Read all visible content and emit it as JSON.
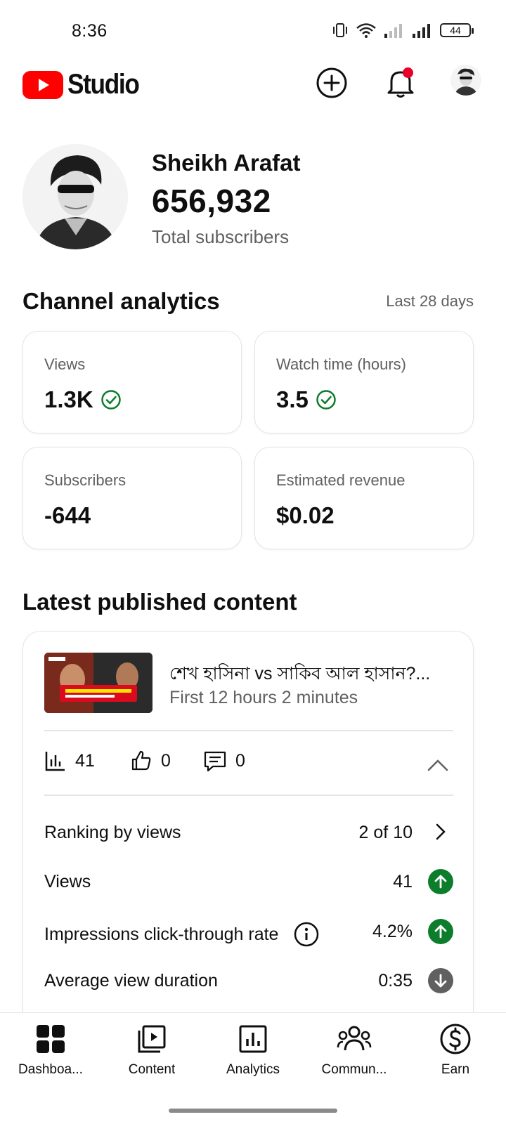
{
  "status_bar": {
    "time": "8:36",
    "battery": "44"
  },
  "header": {
    "logo_text": "Studio",
    "brand_color": "#ff0000",
    "notification_dot_color": "#e8002a"
  },
  "channel": {
    "name": "Sheikh Arafat",
    "subscribers": "656,932",
    "subscribers_label": "Total subscribers"
  },
  "analytics": {
    "title": "Channel analytics",
    "period": "Last 28 days",
    "cards": {
      "views": {
        "label": "Views",
        "value": "1.3K"
      },
      "watch_time": {
        "label": "Watch time (hours)",
        "value": "3.5"
      },
      "subscribers": {
        "label": "Subscribers",
        "value": "-644"
      },
      "revenue": {
        "label": "Estimated revenue",
        "value": "$0.02"
      }
    }
  },
  "latest": {
    "title": "Latest published content",
    "video": {
      "title": "শেখ হাসিনা vs সাকিব আল হাসান?...",
      "meta": "First 12 hours 2 minutes"
    },
    "stats": {
      "views": "41",
      "likes": "0",
      "comments": "0"
    },
    "details": {
      "ranking": {
        "label": "Ranking by views",
        "value": "2 of 10"
      },
      "views": {
        "label": "Views",
        "value": "41",
        "trend": "up"
      },
      "ctr": {
        "label": "Impressions click-through rate",
        "value": "4.2%",
        "trend": "up"
      },
      "avd": {
        "label": "Average view duration",
        "value": "0:35",
        "trend": "down"
      }
    },
    "trend_colors": {
      "up": "#0b7d2b",
      "down": "#606060"
    }
  },
  "bottom_nav": {
    "dashboard": "Dashboa...",
    "content": "Content",
    "analytics": "Analytics",
    "community": "Commun...",
    "earn": "Earn"
  }
}
